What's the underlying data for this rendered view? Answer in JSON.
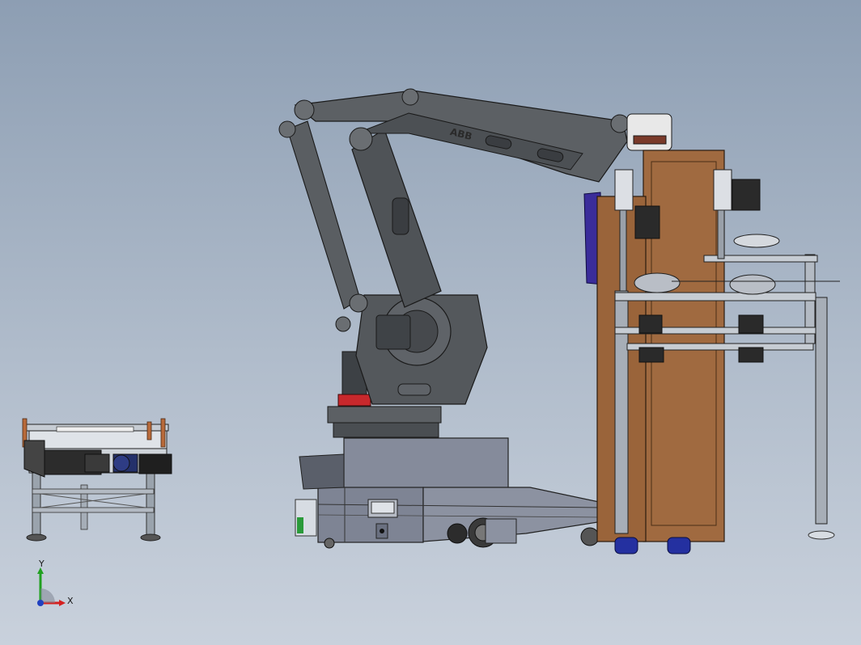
{
  "viewport": {
    "background_top": "#8d9eb3",
    "background_bottom": "#c9d1dc"
  },
  "robot": {
    "brand": "ABB",
    "body_color": "#54585c",
    "accent_red": "#c8282c"
  },
  "agv_base": {
    "body_color": "#7e8494"
  },
  "cabinet": {
    "wood_color": "#a06a40"
  },
  "triad": {
    "x_label": "X",
    "y_label": "Y",
    "x_color": "#d42020",
    "y_color": "#20a020",
    "z_color": "#2040c0"
  }
}
